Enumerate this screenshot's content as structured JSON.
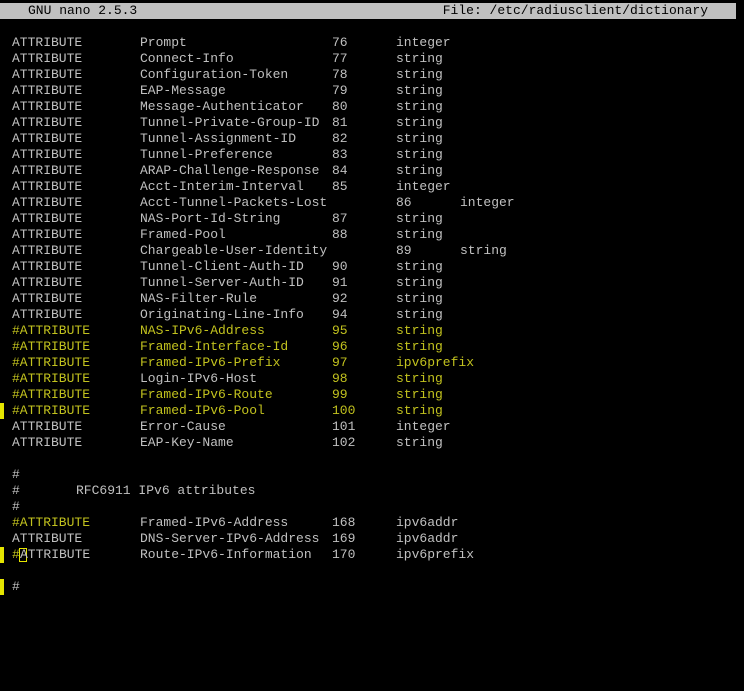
{
  "titlebar": {
    "app": "GNU nano 2.5.3",
    "file": "File: /etc/radiusclient/dictionary"
  },
  "lines": [
    {
      "kw": "ATTRIBUTE",
      "name": "Prompt",
      "id": "76",
      "type": "integer"
    },
    {
      "kw": "ATTRIBUTE",
      "name": "Connect-Info",
      "id": "77",
      "type": "string"
    },
    {
      "kw": "ATTRIBUTE",
      "name": "Configuration-Token",
      "id": "78",
      "type": "string"
    },
    {
      "kw": "ATTRIBUTE",
      "name": "EAP-Message",
      "id": "79",
      "type": "string"
    },
    {
      "kw": "ATTRIBUTE",
      "name": "Message-Authenticator",
      "id": "80",
      "type": "string"
    },
    {
      "kw": "ATTRIBUTE",
      "name": "Tunnel-Private-Group-ID",
      "id": "81",
      "type": "string"
    },
    {
      "kw": "ATTRIBUTE",
      "name": "Tunnel-Assignment-ID",
      "id": "82",
      "type": "string"
    },
    {
      "kw": "ATTRIBUTE",
      "name": "Tunnel-Preference",
      "id": "83",
      "type": "string"
    },
    {
      "kw": "ATTRIBUTE",
      "name": "ARAP-Challenge-Response",
      "id": "84",
      "type": "string"
    },
    {
      "kw": "ATTRIBUTE",
      "name": "Acct-Interim-Interval",
      "id": "85",
      "type": "integer"
    },
    {
      "kw": "ATTRIBUTE",
      "name": "Acct-Tunnel-Packets-Lost",
      "id": "86",
      "type": "integer"
    },
    {
      "kw": "ATTRIBUTE",
      "name": "NAS-Port-Id-String",
      "id": "87",
      "type": "string"
    },
    {
      "kw": "ATTRIBUTE",
      "name": "Framed-Pool",
      "id": "88",
      "type": "string"
    },
    {
      "kw": "ATTRIBUTE",
      "name": "Chargeable-User-Identity",
      "id": "89",
      "type": "string"
    },
    {
      "kw": "ATTRIBUTE",
      "name": "Tunnel-Client-Auth-ID",
      "id": "90",
      "type": "string"
    },
    {
      "kw": "ATTRIBUTE",
      "name": "Tunnel-Server-Auth-ID",
      "id": "91",
      "type": "string"
    },
    {
      "kw": "ATTRIBUTE",
      "name": "NAS-Filter-Rule",
      "id": "92",
      "type": "string"
    },
    {
      "kw": "ATTRIBUTE",
      "name": "Originating-Line-Info",
      "id": "94",
      "type": "string"
    },
    {
      "kw": "#ATTRIBUTE",
      "name": "NAS-IPv6-Address",
      "id": "95",
      "type": "string"
    },
    {
      "kw": "#ATTRIBUTE",
      "name": "Framed-Interface-Id",
      "id": "96",
      "type": "string"
    },
    {
      "kw": "#ATTRIBUTE",
      "name": "Framed-IPv6-Prefix",
      "id": "97",
      "type": "ipv6prefix"
    },
    {
      "kw": "#ATTRIBUTE",
      "name": "Login-IPv6-Host",
      "id": "98",
      "type": "string"
    },
    {
      "kw": "#ATTRIBUTE",
      "name": "Framed-IPv6-Route",
      "id": "99",
      "type": "string"
    },
    {
      "kw": "#ATTRIBUTE",
      "name": "Framed-IPv6-Pool",
      "id": "100",
      "type": "string"
    },
    {
      "kw": "ATTRIBUTE",
      "name": "Error-Cause",
      "id": "101",
      "type": "integer"
    },
    {
      "kw": "ATTRIBUTE",
      "name": "EAP-Key-Name",
      "id": "102",
      "type": "string"
    },
    {
      "blank": ""
    },
    {
      "hash": "#"
    },
    {
      "hash": "#",
      "text": "RFC6911 IPv6 attributes"
    },
    {
      "hash": "#"
    },
    {
      "kw": "#ATTRIBUTE",
      "name": "Framed-IPv6-Address",
      "id": "168",
      "type": "ipv6addr"
    },
    {
      "kw": "ATTRIBUTE",
      "name": "DNS-Server-IPv6-Address",
      "id": "169",
      "type": "ipv6addr"
    },
    {
      "kw_hash": "#",
      "kw": "ATTRIBUTE",
      "name": "Route-IPv6-Information",
      "id": "170",
      "type": "ipv6prefix"
    },
    {
      "blank": ""
    },
    {
      "hash": "#"
    }
  ]
}
